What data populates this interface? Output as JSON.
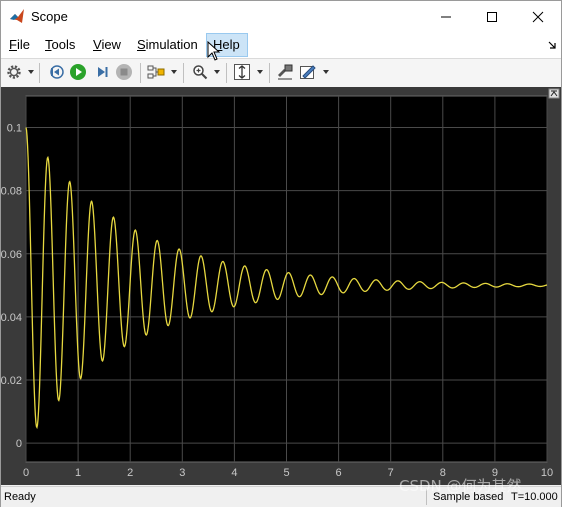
{
  "window": {
    "title": "Scope"
  },
  "menu": [
    {
      "label": "File",
      "mnemonic": "F",
      "rest": "ile"
    },
    {
      "label": "Tools",
      "mnemonic": "T",
      "rest": "ools"
    },
    {
      "label": "View",
      "mnemonic": "V",
      "rest": "iew"
    },
    {
      "label": "Simulation",
      "mnemonic": "S",
      "rest": "imulation"
    },
    {
      "label": "Help",
      "mnemonic": "H",
      "rest": "elp"
    }
  ],
  "toolbar": {
    "icons": [
      "gear-icon",
      "step-back-icon",
      "run-icon",
      "step-forward-icon",
      "stop-icon",
      "signal-selector-icon",
      "zoom-icon",
      "autoscale-icon",
      "highlight-block-icon",
      "style-icon"
    ]
  },
  "status": {
    "ready": "Ready",
    "sample": "Sample based",
    "time": "T=10.000"
  },
  "watermark": "CSDN @何为其然",
  "colors": {
    "signal": "#e6d840",
    "plot_bg": "#000000",
    "frame_bg": "#3a3a3a",
    "grid": "#4a4a4a",
    "tick_text": "#c8c8c8"
  },
  "chart_data": {
    "type": "line",
    "title": "",
    "xlabel": "",
    "ylabel": "",
    "xlim": [
      0,
      10
    ],
    "ylim": [
      -0.006,
      0.11
    ],
    "xticks": [
      0,
      1,
      2,
      3,
      4,
      5,
      6,
      7,
      8,
      9,
      10
    ],
    "yticks": [
      0,
      0.02,
      0.04,
      0.06,
      0.08,
      0.1
    ],
    "ytick_labels": [
      "0",
      "0.02",
      "0.04",
      "0.06",
      "0.08",
      "0.1"
    ],
    "grid": true,
    "series": [
      {
        "model": "damped_oscillation",
        "steady_value": 0.05,
        "initial_value": 0.1,
        "decay_rate": 0.5,
        "period": 0.42,
        "sample_step": 0.01
      }
    ]
  }
}
